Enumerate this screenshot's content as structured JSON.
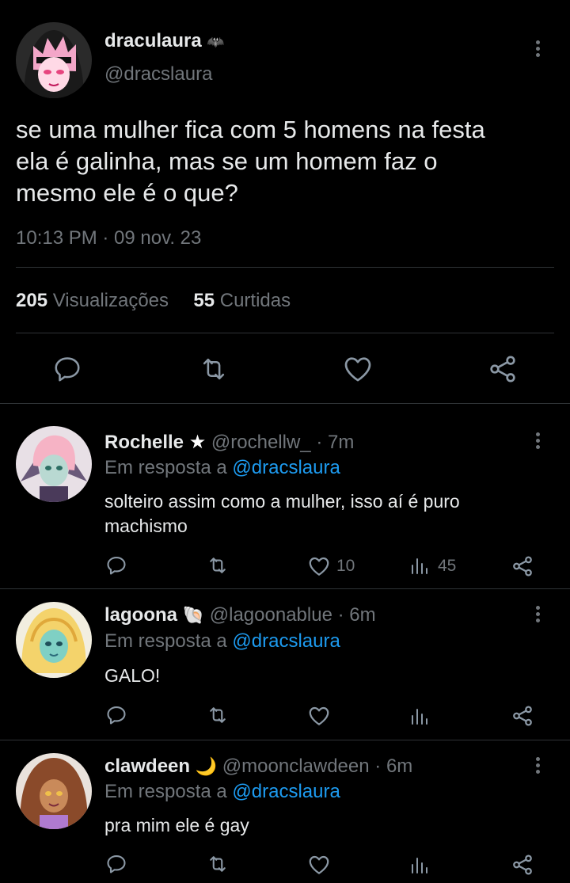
{
  "main_tweet": {
    "display_name": "draculaura",
    "name_emoji": "🦇",
    "handle": "@dracslaura",
    "text_lines": [
      "se uma mulher fica com 5 homens na festa",
      "ela é galinha, mas se um homem faz o",
      "mesmo ele é o que?"
    ],
    "timestamp": "10:13 PM · 09 nov. 23",
    "views_count": "205",
    "views_label": "Visualizações",
    "likes_count": "55",
    "likes_label": "Curtidas",
    "avatar_colors": [
      "#f3a6c8",
      "#1a1a1a",
      "#ffffff"
    ]
  },
  "replies": [
    {
      "display_name": "Rochelle",
      "name_emoji": "★",
      "handle": "@rochellw_",
      "time": "· 7m",
      "reply_prefix": "Em resposta a",
      "reply_to": "@dracslaura",
      "text_lines": [
        "solteiro assim como a mulher, isso aí é puro",
        "machismo"
      ],
      "like_count": "10",
      "view_count": "45",
      "avatar_colors": [
        "#b9d9d2",
        "#f6b3c5",
        "#5a4a6a"
      ]
    },
    {
      "display_name": "lagoona",
      "name_emoji": "🐚",
      "handle": "@lagoonablue",
      "time": "· 6m",
      "reply_prefix": "Em resposta a",
      "reply_to": "@dracslaura",
      "text_lines": [
        "GALO!"
      ],
      "like_count": "",
      "view_count": "",
      "avatar_colors": [
        "#f4d36b",
        "#7fd0c4",
        "#2b6b7a"
      ]
    },
    {
      "display_name": "clawdeen",
      "name_emoji": "🌙",
      "handle": "@moonclawdeen",
      "time": "· 6m",
      "reply_prefix": "Em resposta a",
      "reply_to": "@dracslaura",
      "text_lines": [
        "pra mim ele é gay"
      ],
      "like_count": "",
      "view_count": "",
      "avatar_colors": [
        "#8a4a2a",
        "#c98a5a",
        "#3a1e14"
      ]
    }
  ],
  "colors": {
    "background": "#000000",
    "text": "#e7e9ea",
    "muted": "#71767b",
    "link": "#1d9bf0",
    "divider": "#2f3336"
  },
  "icons": [
    "reply-icon",
    "retweet-icon",
    "like-icon",
    "share-icon",
    "views-icon",
    "more-icon"
  ]
}
